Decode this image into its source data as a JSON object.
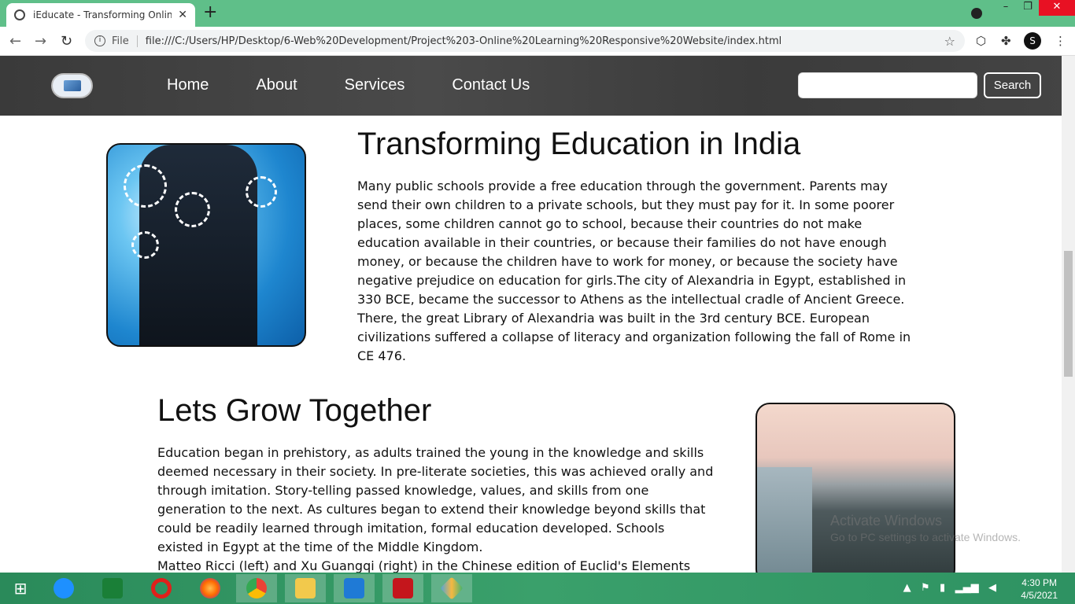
{
  "browser": {
    "tab_title": "iEducate - Transforming Online E",
    "tab_close": "✕",
    "new_tab": "+",
    "back": "←",
    "forward": "→",
    "reload": "↻",
    "file_label": "File",
    "url": "file:///C:/Users/HP/Desktop/6-Web%20Development/Project%203-Online%20Learning%20Responsive%20Website/index.html",
    "bookmark": "☆",
    "profile_initial": "S"
  },
  "site_nav": {
    "menu": [
      "Home",
      "About",
      "Services",
      "Contact Us"
    ],
    "search_value": "",
    "search_button": "Search"
  },
  "section1": {
    "heading": "Transforming Education in India",
    "lines": [
      "Many public schools provide a free education through the government. Parents may",
      "send their own children to a private schools, but they must pay for it. In some poorer",
      "places, some children cannot go to school, because their countries do not make",
      "education available in their countries, or because their families do not have enough",
      "money, or because the children have to work for money, or because the society have",
      "negative prejudice on education for girls.The city of Alexandria in Egypt, established in",
      "330 BCE, became the successor to Athens as the intellectual cradle of Ancient Greece.",
      "There, the great Library of Alexandria was built in the 3rd century BCE. European",
      "civilizations suffered a collapse of literacy and organization following the fall of Rome in",
      "CE 476."
    ]
  },
  "section2": {
    "heading": "Lets Grow Together",
    "lines": [
      "Education began in prehistory, as adults trained the young in the knowledge and skills",
      "deemed necessary in their society. In pre-literate societies, this was achieved orally and",
      "through imitation. Story-telling passed knowledge, values, and skills from one",
      "generation to the next. As cultures began to extend their knowledge beyond skills that",
      "could be readily learned through imitation, formal education developed. Schools",
      "existed in Egypt at the time of the Middle Kingdom.",
      "Matteo Ricci (left) and Xu Guangqi (right) in the Chinese edition of Euclid's Elements"
    ]
  },
  "watermark": {
    "line1": "Activate Windows",
    "line2": "Go to PC settings to activate Windows."
  },
  "taskbar": {
    "time": "4:30 PM",
    "date": "4/5/2021"
  }
}
